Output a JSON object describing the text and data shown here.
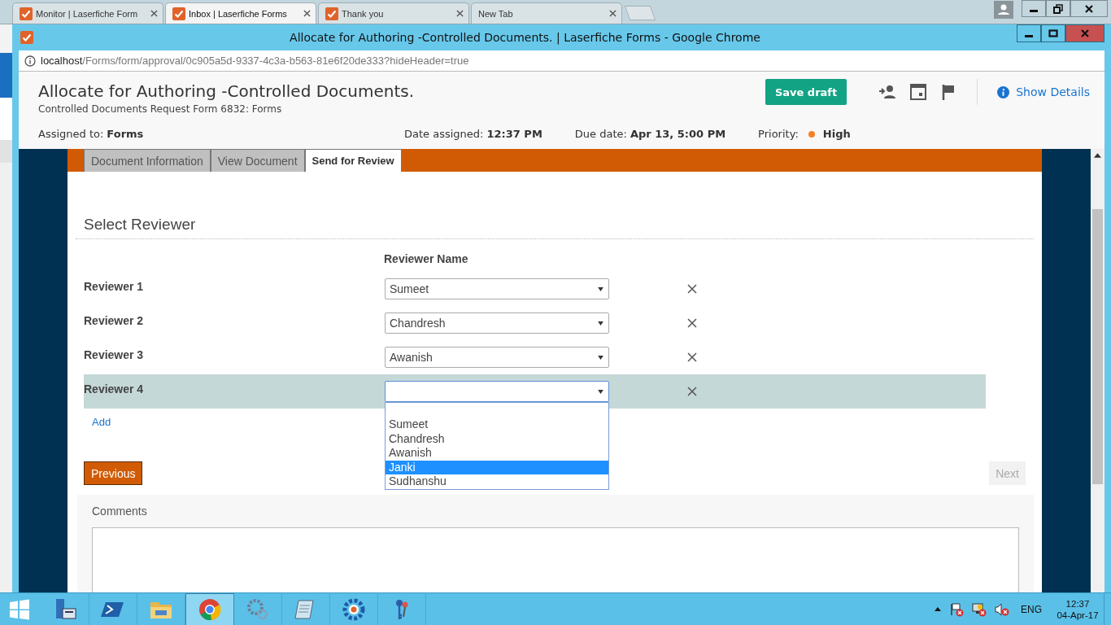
{
  "browser_tabs": [
    {
      "title": "Monitor | Laserfiche Form",
      "selected": false
    },
    {
      "title": "Inbox | Laserfiche Forms",
      "selected": true
    },
    {
      "title": "Thank you",
      "selected": false
    },
    {
      "title": "New Tab",
      "selected": false,
      "kind": "blank"
    }
  ],
  "window": {
    "title": "Allocate for Authoring -Controlled Documents. | Laserfiche Forms - Google Chrome"
  },
  "address_bar": {
    "host": "localhost",
    "path": "/Forms/form/approval/0c905a5d-9337-4c3a-b563-81e6f20de333?hideHeader=true"
  },
  "header": {
    "title": "Allocate for Authoring -Controlled Documents.",
    "subtitle": "Controlled Documents Request Form 6832: Forms",
    "save_button": "Save draft",
    "details_link": "Show Details",
    "meta": [
      {
        "label": "Assigned to:",
        "value": "Forms"
      },
      {
        "label": "Date assigned:",
        "value": "12:37 PM"
      },
      {
        "label": "Due date:",
        "value": "Apr 13, 5:00 PM"
      },
      {
        "label": "Priority:",
        "value": "High",
        "color": "#f5802a"
      }
    ]
  },
  "form_tabs": [
    {
      "label": "Document Information",
      "selected": false
    },
    {
      "label": "View Document",
      "selected": false
    },
    {
      "label": "Send for Review",
      "selected": true
    }
  ],
  "section_title": "Select Reviewer",
  "column_header": "Reviewer Name",
  "reviewers": [
    {
      "label": "Reviewer 1",
      "value": "Sumeet",
      "selected": false
    },
    {
      "label": "Reviewer 2",
      "value": "Chandresh",
      "selected": false
    },
    {
      "label": "Reviewer 3",
      "value": "Awanish",
      "selected": false
    },
    {
      "label": "Reviewer 4",
      "selected": true,
      "options": [
        {
          "label": "Sumeet",
          "selected": false
        },
        {
          "label": "Chandresh",
          "selected": false
        },
        {
          "label": "Awanish",
          "selected": false
        },
        {
          "label": "Janki",
          "selected": true
        },
        {
          "label": "Sudhanshu",
          "selected": false
        }
      ]
    }
  ],
  "add_link": "Add",
  "previous_button": "Previous",
  "next_button": {
    "label": "Next",
    "disabled": true
  },
  "comments_label": "Comments",
  "taskbar": {
    "language": "ENG",
    "time": "12:37",
    "date": "04-Apr-17"
  }
}
